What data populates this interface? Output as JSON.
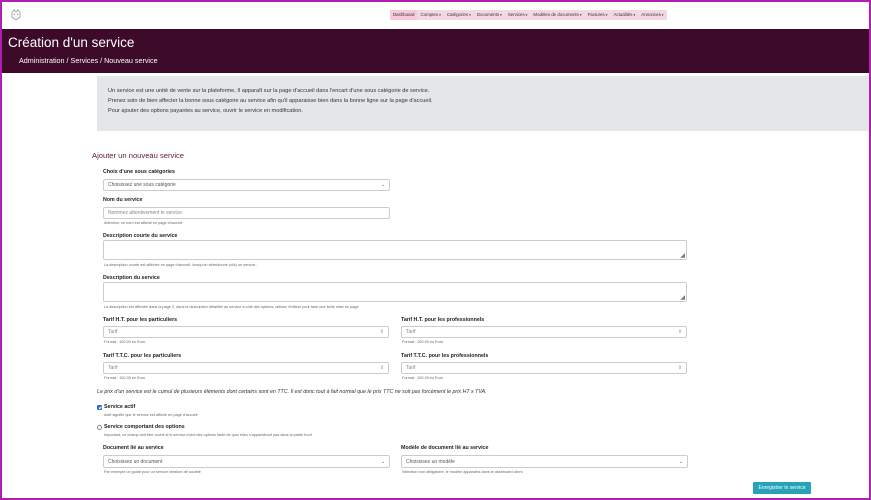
{
  "nav": {
    "items": [
      {
        "label": "Dashboard",
        "caret": false
      },
      {
        "label": "Comptes",
        "caret": true
      },
      {
        "label": "Catégories",
        "caret": true
      },
      {
        "label": "Documents",
        "caret": true
      },
      {
        "label": "Services",
        "caret": true
      },
      {
        "label": "Modèles de documents",
        "caret": true
      },
      {
        "label": "Factures",
        "caret": true
      },
      {
        "label": "Actualités",
        "caret": true
      },
      {
        "label": "Annonces",
        "caret": true
      }
    ],
    "caret_glyph": "▾"
  },
  "header": {
    "title": "Création d'un service",
    "breadcrumb": "Administration / Services / Nouveau service"
  },
  "info": {
    "lines": [
      "Un service est une unité de vente sur la plateforme, Il apparaît sur la page d'accueil dans l'encart d'une sous catégorie de service.",
      "Prenez soin de bien affecter la bonne sous catégorie au service afin qu'il apparaisse bien dans la bonne ligne sur la page d'accueil.",
      "Pour ajouter des options payantes au service, ouvrir le service en modification."
    ]
  },
  "form": {
    "section_title": "Ajouter un nouveau service",
    "subcategory": {
      "label": "Choix d'une sous catégories",
      "value": "Choisissez une sous catégorie"
    },
    "name": {
      "label": "Nom du service",
      "placeholder": "Nommez attentivement le service",
      "help": "Attention, ce nom est affiché en page d'accueil"
    },
    "short_description": {
      "label": "Description courte du service",
      "help": "La description courte est affichée en page d'accueil, lorsqu'on sélectionne (clic) un service..."
    },
    "description": {
      "label": "Description du service",
      "help": "La description est affichée dans la page 2, dans la description détaillée du service à côté des options, utilisez l'éditeur pour faire une belle mise en page"
    },
    "price_ht_particuliers": {
      "label": "Tarif H.T. pour les particuliers",
      "placeholder": "Tarif",
      "help": "Format : 100.00 en Euro"
    },
    "price_ht_pros": {
      "label": "Tarif H.T. pour les professionnels",
      "placeholder": "Tarif",
      "help": "Format : 100.00 en Euro"
    },
    "price_ttc_particuliers": {
      "label": "Tarif T.T.C. pour les particuliers",
      "placeholder": "Tarif",
      "help": "Format : 100.00 en Euro"
    },
    "price_ttc_pros": {
      "label": "Tarif T.T.C. pour les professionnels",
      "placeholder": "Tarif",
      "help": "Format : 100.00 en Euro"
    },
    "price_note": "Le prix d'un service est le cumul de plusieurs éléments dont certains sont en TTC. Il est donc tout à fait normal que le prix TTC ne soit pas forcément le prix HT x TVA.",
    "active": {
      "label": "Service actif",
      "checked": true,
      "help": "Actif signifie que le service est affiché en page d'accueil"
    },
    "with_options": {
      "label": "Service comportant des options",
      "checked": false,
      "help": "Important, ce champ doit être coché si le service inclut des options faute de quoi elles n'apparaîtront pas dans la partie front"
    },
    "linked_document": {
      "label": "Document lié au service",
      "value": "Choisissez un document",
      "help": "Par exemple un guide pour un service création de société"
    },
    "linked_template": {
      "label": "Modèle de document lié au service",
      "value": "Choisissez un modèle",
      "help": "Sélection non obligatoire, le modèle apparaitra dans le dashboard client"
    },
    "submit_label": "Enregistrer le service"
  },
  "icons": {
    "chevron": "⌄",
    "spinner": "⇳",
    "resize": "◢"
  },
  "colors": {
    "header_bg": "#3d0a2a",
    "nav_bg": "#f3d7e3",
    "button_bg": "#25a3b8",
    "info_bg": "#e4e6ea",
    "section_title": "#5a1a3d"
  }
}
